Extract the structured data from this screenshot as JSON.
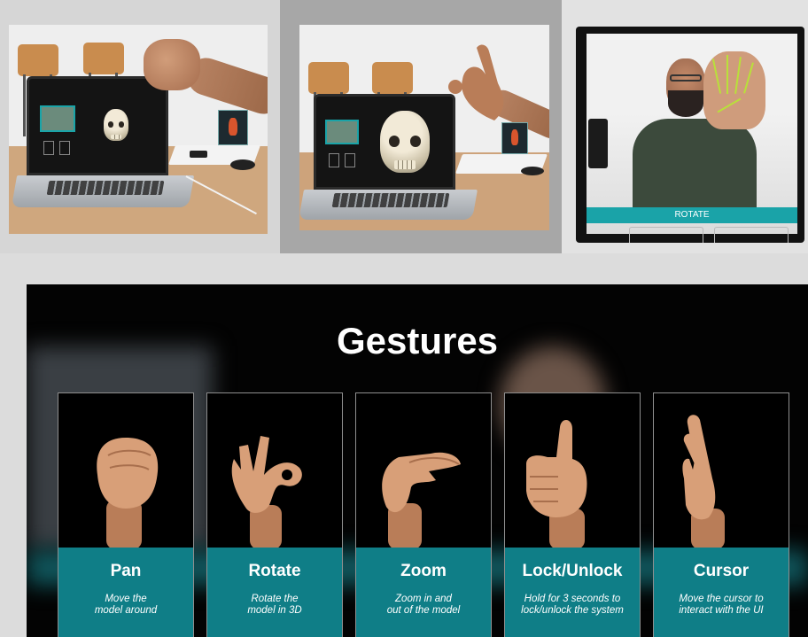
{
  "photos": {
    "third": {
      "button_label": "ROTATE"
    }
  },
  "gestures": {
    "title": "Gestures",
    "cards": [
      {
        "name": "Pan",
        "description": "Move the\nmodel around",
        "icon": "fist-icon"
      },
      {
        "name": "Rotate",
        "description": "Rotate the\nmodel in 3D",
        "icon": "ok-hand-icon"
      },
      {
        "name": "Zoom",
        "description": "Zoom in and\nout of the model",
        "icon": "pinch-hand-icon"
      },
      {
        "name": "Lock/Unlock",
        "description": "Hold for 3 seconds to\nlock/unlock the system",
        "icon": "thumbs-up-icon"
      },
      {
        "name": "Cursor",
        "description": "Move the cursor to\ninteract with the UI",
        "icon": "two-fingers-icon"
      }
    ]
  },
  "colors": {
    "card_band": "#0f7e87",
    "panel_background": "#030303",
    "accent_teal": "#1aa3a8"
  }
}
